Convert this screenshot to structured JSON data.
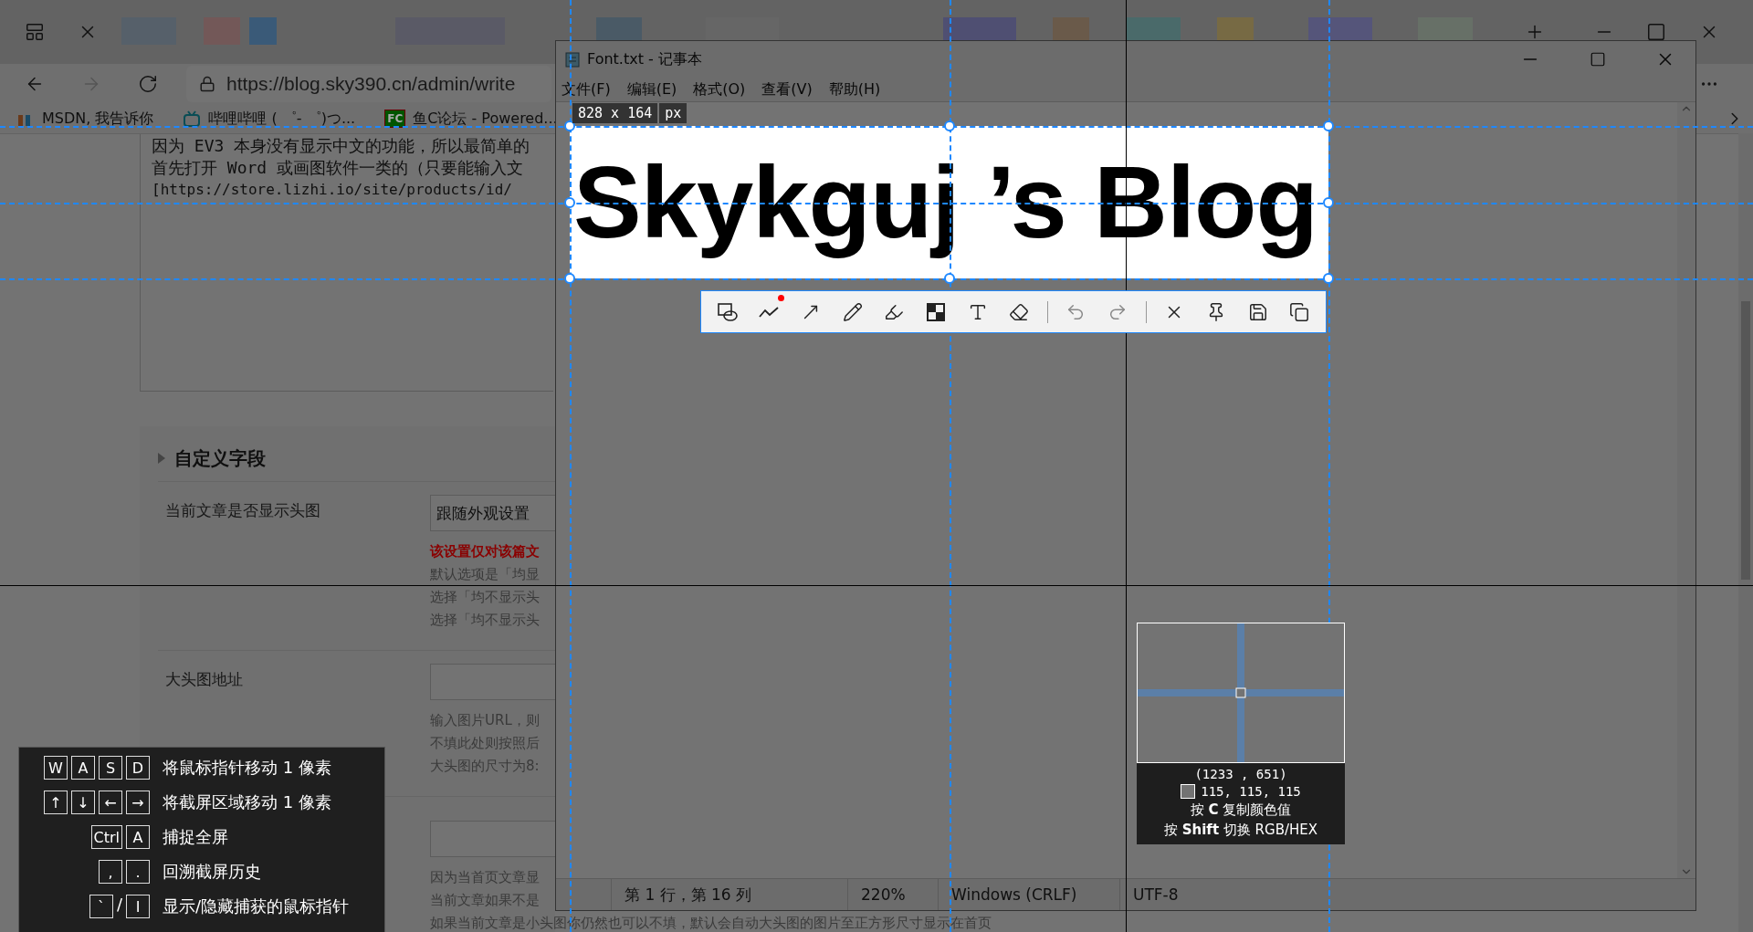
{
  "browser": {
    "address": "https://blog.sky390.cn/admin/write",
    "bookmarks": [
      {
        "label": "MSDN, 我告诉你"
      },
      {
        "label": "哔哩哔哩 ( ゜- ゜)つ..."
      },
      {
        "label": "鱼C论坛 - Powered...",
        "badge": "FC"
      }
    ]
  },
  "page": {
    "editor_lines": [
      "因为 EV3 本身没有显示中文的功能，所以最简单的",
      "首先打开 Word 或画图软件一类的（只要能输入文",
      "[https://store.lizhi.io/site/products/id/"
    ],
    "section_title": "自定义字段",
    "fields": [
      {
        "label": "当前文章是否显示头图",
        "kind": "select",
        "value": "跟随外观设置",
        "notes": [
          {
            "kind": "warning",
            "text": "该设置仅对该篇文"
          },
          {
            "kind": "hint",
            "text": "默认选项是「均显"
          },
          {
            "kind": "hint",
            "text": "选择「均不显示头"
          },
          {
            "kind": "hint",
            "text": "选择「均不显示头"
          }
        ]
      },
      {
        "label": "大头图地址",
        "kind": "input",
        "notes": [
          {
            "kind": "hint",
            "text": "输入图片URL，则"
          },
          {
            "kind": "hint",
            "text": "不填此处则按照后"
          },
          {
            "kind": "hint",
            "text": "大头图的尺寸为8:"
          }
        ]
      },
      {
        "kind": "input",
        "notes": [
          {
            "kind": "hint",
            "text": "因为当首页文章显"
          },
          {
            "kind": "hint",
            "text": "当前文章如果不是"
          },
          {
            "kind": "hint",
            "text": "如果当前文章是小头图你仍然也可以不填，默认会自动大头图的图片至正方形尺寸显示在首页"
          }
        ]
      }
    ]
  },
  "notepad": {
    "title": "Font.txt - 记事本",
    "menu": [
      "文件(F)",
      "编辑(E)",
      "格式(O)",
      "查看(V)",
      "帮助(H)"
    ],
    "text": "Skykguj ’s Blog",
    "status": [
      "第 1 行，第 16 列",
      "220%",
      "Windows (CRLF)",
      "UTF-8"
    ]
  },
  "capture": {
    "size": "828 x 164",
    "unit": "px",
    "magnifier": {
      "coords": "(1233 , 651)",
      "color": "#737373",
      "rgb": "115, 115, 115",
      "hints": [
        "按 **C** 复制颜色值",
        "按 **Shift** 切换 RGB/HEX"
      ]
    },
    "shortcuts": [
      {
        "keys": [
          "W",
          "A",
          "S",
          "D"
        ],
        "text": "将鼠标指针移动 1 像素"
      },
      {
        "keys": [
          "↑",
          "↓",
          "←",
          "→"
        ],
        "text": "将截屏区域移动 1 像素"
      },
      {
        "keys": [
          "Ctrl",
          "A"
        ],
        "text": "捕捉全屏"
      },
      {
        "keys": [
          ",",
          "."
        ],
        "text": "回溯截屏历史"
      },
      {
        "keys": [
          "`",
          "/",
          "I"
        ],
        "text": "显示/隐藏捕获的鼠标指针"
      }
    ]
  }
}
